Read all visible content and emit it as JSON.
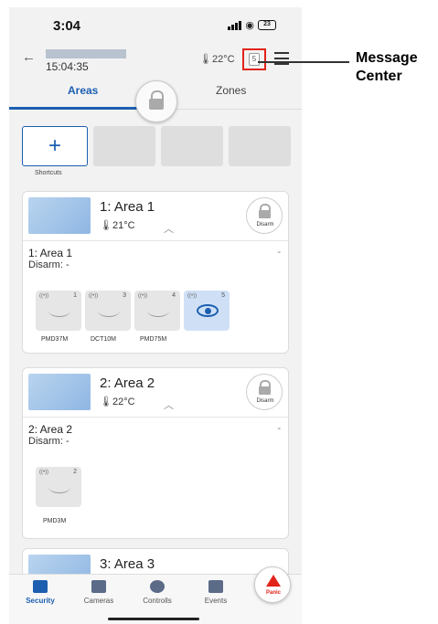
{
  "status_bar": {
    "time": "3:04",
    "battery": "23"
  },
  "header": {
    "time": "15:04:35",
    "temperature": "22°C",
    "message_count": "5"
  },
  "tabs": [
    {
      "label": "Areas",
      "active": true
    },
    {
      "label": "Zones",
      "active": false
    }
  ],
  "shortcuts": {
    "add_label": "+",
    "label": "Shortcuts"
  },
  "areas": [
    {
      "title": "1: Area 1",
      "temp": "21°C",
      "button_label": "Disarm",
      "body_title": "1: Area 1",
      "body_status": "Disarm: -",
      "zones": [
        {
          "num": "1",
          "label": "PMD37M"
        },
        {
          "num": "3",
          "label": "DCT10M"
        },
        {
          "num": "4",
          "label": "PMD75M"
        },
        {
          "num": "5",
          "label": ""
        }
      ]
    },
    {
      "title": "2: Area 2",
      "temp": "22°C",
      "button_label": "Disarm",
      "body_title": "2: Area 2",
      "body_status": "Disarm: -",
      "zones": [
        {
          "num": "2",
          "label": "PMD3M"
        }
      ]
    },
    {
      "title": "3: Area 3"
    }
  ],
  "bottom_nav": [
    {
      "label": "Security",
      "icon": "lock-icon",
      "active": true
    },
    {
      "label": "Cameras",
      "icon": "camera-icon"
    },
    {
      "label": "Controlls",
      "icon": "bulb-icon"
    },
    {
      "label": "Events",
      "icon": "events-icon"
    }
  ],
  "panic": {
    "label": "Panic"
  },
  "annotation": {
    "line1": "Message",
    "line2": "Center"
  },
  "colors": {
    "accent": "#1c5fb0",
    "alert": "#e2231a"
  }
}
